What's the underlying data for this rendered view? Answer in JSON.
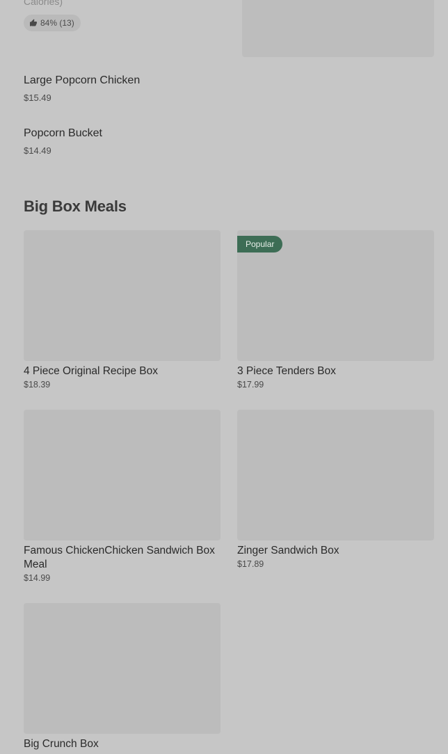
{
  "previous_item": {
    "calories_fragment": "Calories)",
    "rating": "84% (13)"
  },
  "simple_items": [
    {
      "name": "Large Popcorn Chicken",
      "price": "$15.49"
    },
    {
      "name": "Popcorn Bucket",
      "price": "$14.49"
    }
  ],
  "section": {
    "title": "Big Box Meals",
    "items": [
      {
        "name": "4 Piece Original Recipe Box",
        "price": "$18.39",
        "badge": ""
      },
      {
        "name": "3 Piece Tenders Box",
        "price": "$17.99",
        "badge": "Popular"
      },
      {
        "name": "Famous ChickenChicken Sandwich Box Meal",
        "price": "$14.99",
        "badge": ""
      },
      {
        "name": "Zinger Sandwich Box",
        "price": "$17.89",
        "badge": ""
      },
      {
        "name": "Big Crunch Box",
        "price": "",
        "badge": ""
      }
    ]
  },
  "icons": {
    "thumbs_up": "thumbs-up-icon"
  },
  "colors": {
    "background": "#c6c6c6",
    "badge_bg": "#3d6d55",
    "image_placeholder": "#bcbcbc"
  }
}
